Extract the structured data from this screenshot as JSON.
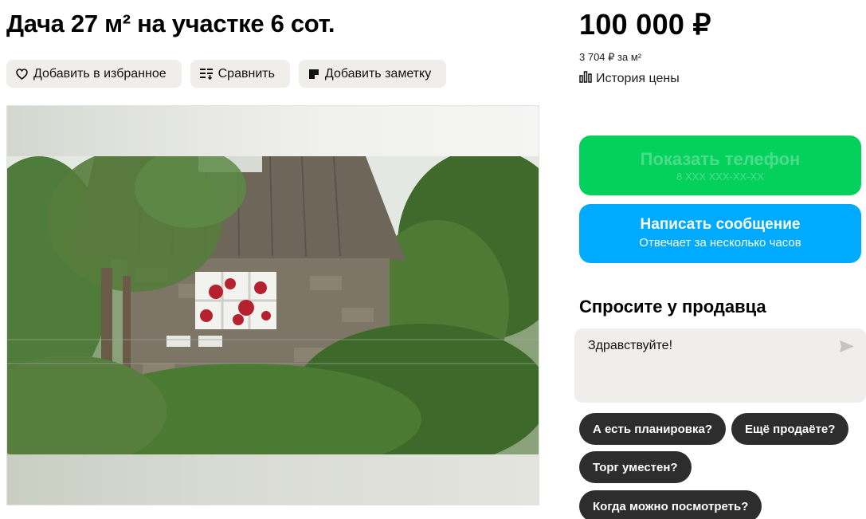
{
  "listing": {
    "title": "Дача 27 м² на участке 6 сот.",
    "price": "100 000 ₽",
    "price_per_m": "3 704 ₽ за м²",
    "price_history_label": "История цены"
  },
  "actions": {
    "favorite_label": "Добавить в избранное",
    "compare_label": "Сравнить",
    "note_label": "Добавить заметку"
  },
  "contact": {
    "phone_label": "Показать телефон",
    "phone_masked": "8 XXX XXX-XX-XX",
    "message_label": "Написать сообщение",
    "message_sub": "Отвечает за несколько часов"
  },
  "ask": {
    "title": "Спросите у продавца",
    "input_value": "Здравствуйте!",
    "quick_questions": [
      "А есть планировка?",
      "Ещё продаёте?",
      "Торг уместен?",
      "Когда можно посмотреть?"
    ]
  },
  "icons": {
    "favorite": "heart-icon",
    "compare": "compare-icon",
    "note": "note-icon",
    "history": "bar-chart-icon",
    "send": "send-icon"
  },
  "colors": {
    "phone_button": "#04d15c",
    "message_button": "#00aaff",
    "chip_bg": "#f0eeeb",
    "quick_bg": "#2d2d2d"
  }
}
